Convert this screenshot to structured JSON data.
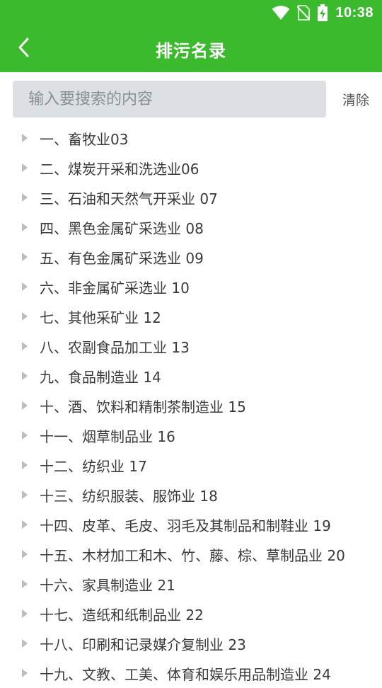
{
  "status_bar": {
    "time": "10:38",
    "icons": [
      "wifi-icon",
      "no-sim-icon",
      "battery-charging-icon"
    ]
  },
  "app_bar": {
    "title": "排污名录",
    "back_icon": "chevron-left-icon"
  },
  "search": {
    "placeholder": "输入要搜索的内容",
    "value": "",
    "clear_label": "清除"
  },
  "colors": {
    "primary": "#3cba2e",
    "search_bg": "#dcdfe4",
    "arrow": "#b9bcc0"
  },
  "list": {
    "items": [
      {
        "label": "一、畜牧业03"
      },
      {
        "label": "二、煤炭开采和洗选业06"
      },
      {
        "label": "三、石油和天然气开采业 07"
      },
      {
        "label": "四、黑色金属矿采选业 08"
      },
      {
        "label": "五、有色金属矿采选业 09"
      },
      {
        "label": "六、非金属矿采选业 10"
      },
      {
        "label": "七、其他采矿业 12"
      },
      {
        "label": "八、农副食品加工业 13"
      },
      {
        "label": "九、食品制造业 14"
      },
      {
        "label": "十、酒、饮料和精制茶制造业 15"
      },
      {
        "label": "十一、烟草制品业 16"
      },
      {
        "label": "十二、纺织业 17"
      },
      {
        "label": "十三、纺织服装、服饰业 18"
      },
      {
        "label": "十四、皮革、毛皮、羽毛及其制品和制鞋业 19"
      },
      {
        "label": "十五、木材加工和木、竹、藤、棕、草制品业 20"
      },
      {
        "label": "十六、家具制造业 21"
      },
      {
        "label": "十七、造纸和纸制品业 22"
      },
      {
        "label": "十八、印刷和记录媒介复制业 23"
      },
      {
        "label": "十九、文教、工美、体育和娱乐用品制造业 24"
      }
    ]
  }
}
